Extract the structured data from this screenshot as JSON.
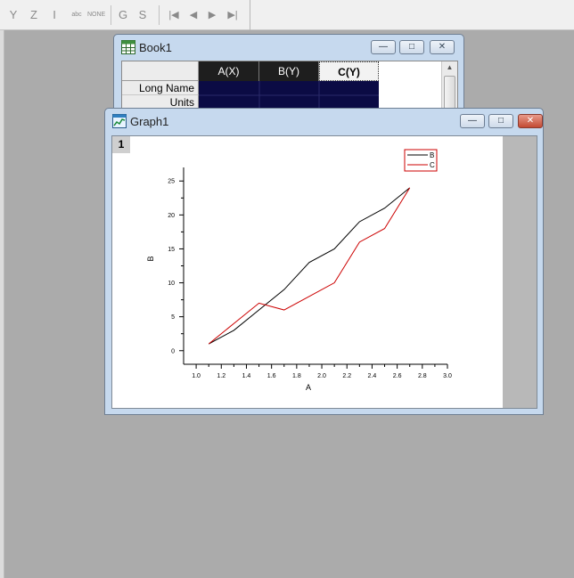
{
  "toolbar": {
    "buttons": [
      "Y",
      "Z",
      "I",
      "abc",
      "NONE",
      "G",
      "S"
    ],
    "nav": [
      "|◀",
      "◀",
      "▶",
      "▶|"
    ]
  },
  "book": {
    "title": "Book1",
    "columns": [
      "A(X)",
      "B(Y)",
      "C(Y)"
    ],
    "rows": [
      "Long Name",
      "Units"
    ]
  },
  "graph": {
    "title": "Graph1",
    "layer_label": "1"
  },
  "window_controls": {
    "minimize": "—",
    "maximize": "□",
    "close": "✕"
  },
  "colors": {
    "series_b": "#000000",
    "series_c": "#cc0000",
    "selected_cells": "#0b0b44"
  },
  "chart_data": {
    "type": "line",
    "xlabel": "A",
    "ylabel": "B",
    "xlim": [
      0.9,
      3.0
    ],
    "ylim": [
      -2,
      27
    ],
    "xticks": [
      1.0,
      1.2,
      1.4,
      1.6,
      1.8,
      2.0,
      2.2,
      2.4,
      2.6,
      2.8,
      3.0
    ],
    "xtick_labels": [
      "1.0",
      "1.2",
      "1.4",
      "1.6",
      "1.8",
      "2.0",
      "2.2",
      "2.4",
      "2.6",
      "2.8",
      "3.0"
    ],
    "yticks": [
      0,
      5,
      10,
      15,
      20,
      25
    ],
    "ytick_labels": [
      "0",
      "5",
      "10",
      "15",
      "20",
      "25"
    ],
    "legend": "top-right",
    "x": [
      1.1,
      1.3,
      1.5,
      1.7,
      1.9,
      2.1,
      2.3,
      2.5,
      2.7
    ],
    "series": [
      {
        "name": "B",
        "color": "#000000",
        "values": [
          1,
          3,
          6,
          9,
          13,
          15,
          19,
          21,
          24
        ]
      },
      {
        "name": "C",
        "color": "#cc0000",
        "values": [
          1,
          4,
          7,
          6,
          8,
          10,
          16,
          18,
          24
        ]
      }
    ]
  }
}
